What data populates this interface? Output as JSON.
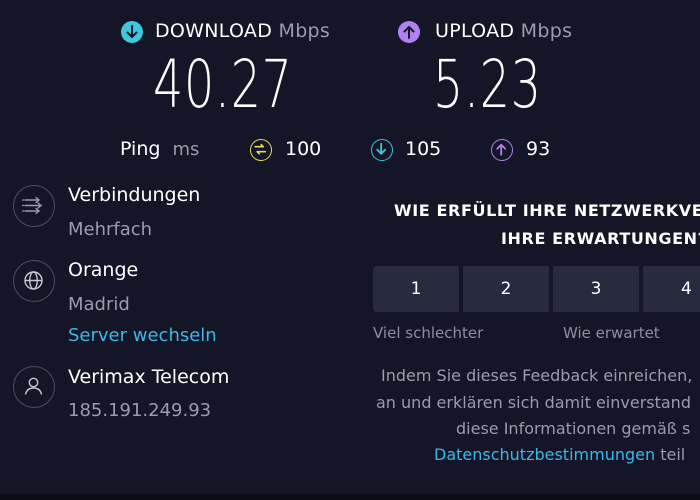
{
  "download": {
    "label": "DOWNLOAD",
    "unit": "Mbps",
    "value": "40.27",
    "icon": "arrow-down-icon",
    "color": "#3ec8e0"
  },
  "upload": {
    "label": "UPLOAD",
    "unit": "Mbps",
    "value": "5.23",
    "icon": "arrow-up-icon",
    "color": "#b181ef"
  },
  "ping": {
    "label": "Ping",
    "unit": "ms",
    "idle": {
      "value": "100",
      "icon": "ping-icon",
      "color": "#ecd85a"
    },
    "download": {
      "value": "105",
      "icon": "arrow-down-icon",
      "color": "#3ec8e0"
    },
    "upload": {
      "value": "93",
      "icon": "arrow-up-icon",
      "color": "#b181ef"
    }
  },
  "connections": {
    "title": "Verbindungen",
    "value": "Mehrfach",
    "icon": "connections-icon"
  },
  "server": {
    "title": "Orange",
    "location": "Madrid",
    "change_link": "Server wechseln",
    "icon": "globe-icon"
  },
  "provider": {
    "title": "Verimax Telecom",
    "ip": "185.191.249.93",
    "icon": "user-icon"
  },
  "feedback": {
    "question_line1": "WIE ERFÜLLT IHRE NETZWERKVERF",
    "question_line2": "IHRE ERWARTUNGEN?",
    "ratings": [
      "1",
      "2",
      "3",
      "4"
    ],
    "label_low": "Viel schlechter",
    "label_mid": "Wie erwartet",
    "text_line1": "Indem Sie dieses Feedback einreichen,",
    "text_line2": "an und erklären sich damit einverstand",
    "text_line3": "diese Informationen gemäß s",
    "privacy_link": "Datenschutzbestimmungen",
    "text_line4_suffix": " teil"
  }
}
